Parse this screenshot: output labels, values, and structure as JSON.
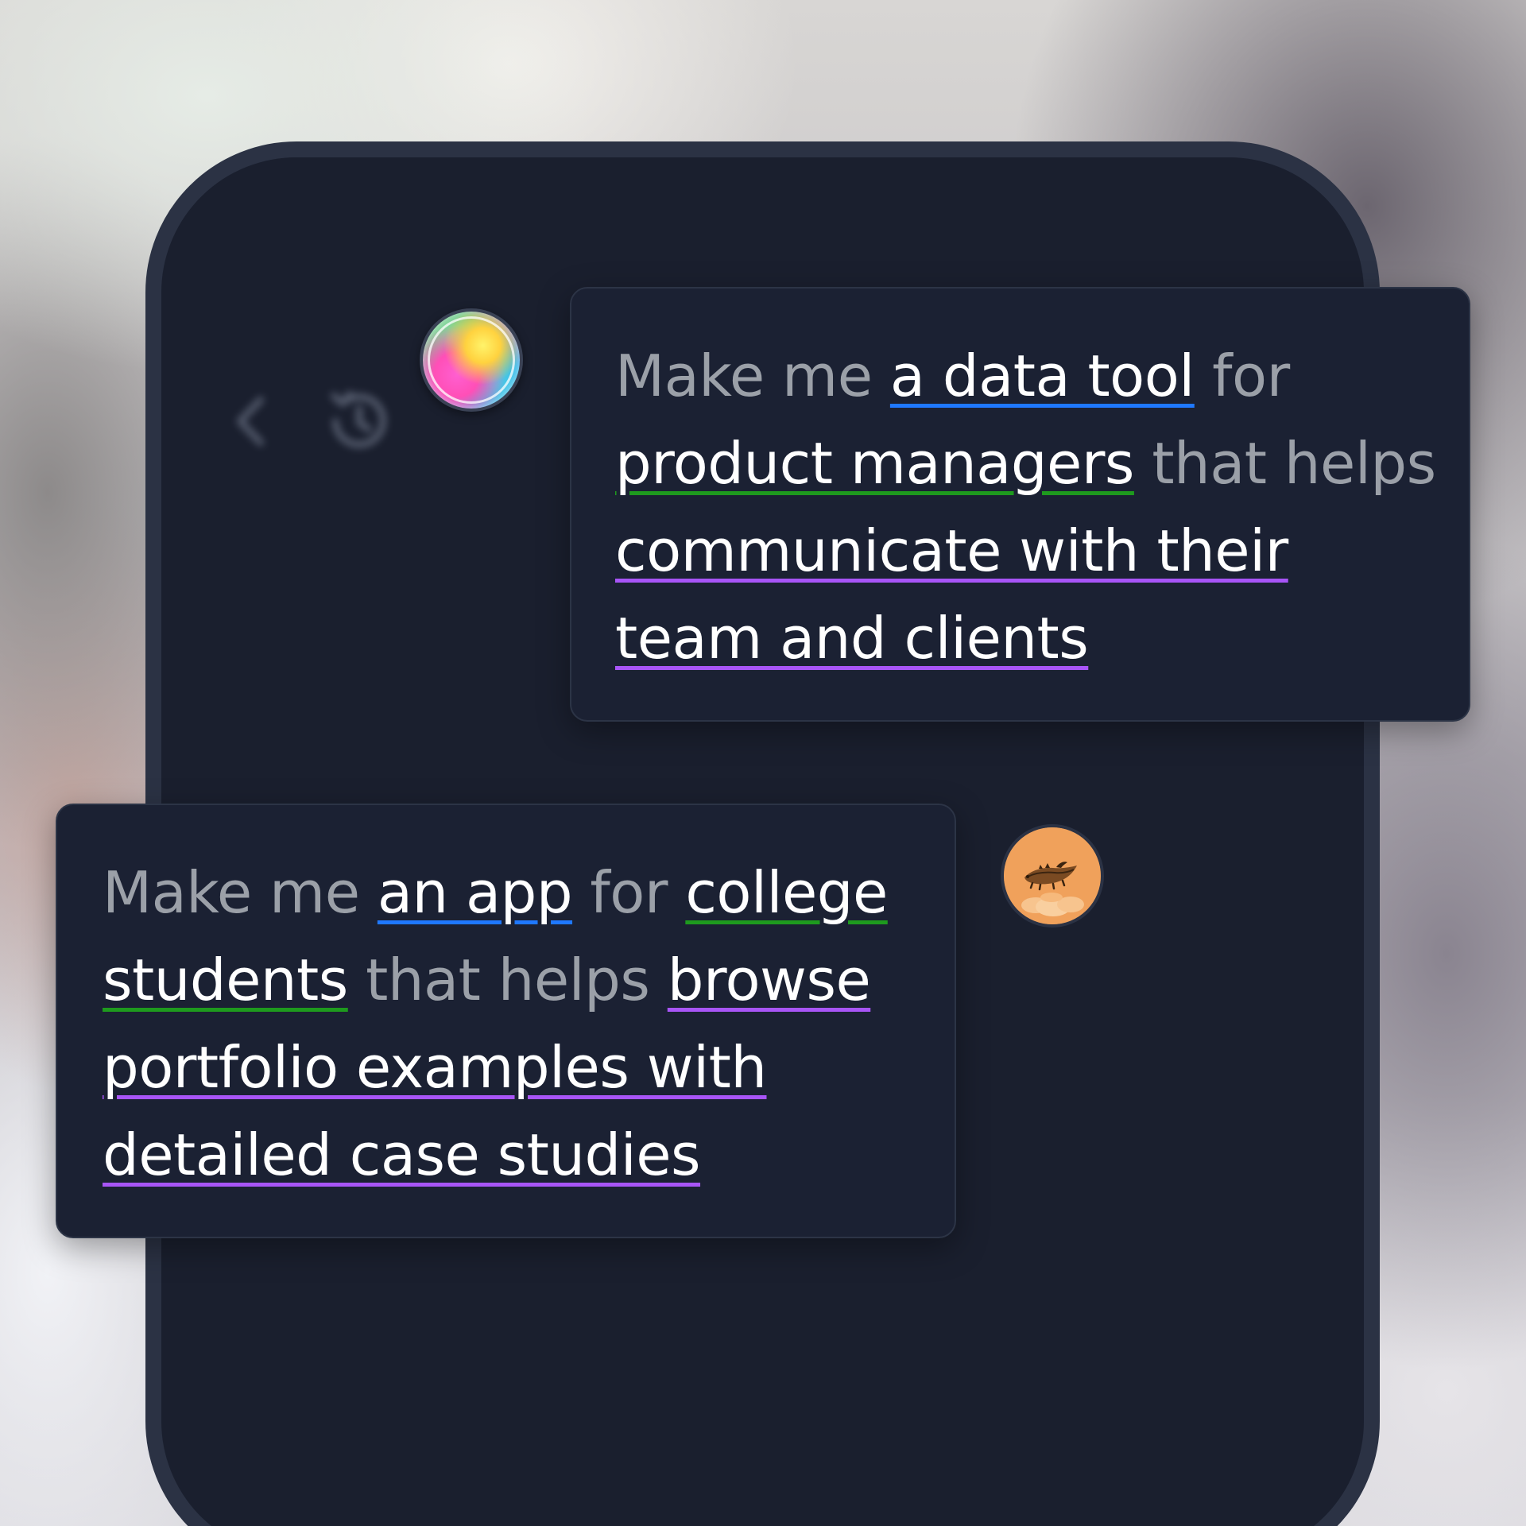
{
  "colors": {
    "phone_bg": "#1a1f2e",
    "bubble_bg": "#1b2133",
    "muted_text": "#9ba0a8",
    "highlight_text": "#ffffff",
    "underline_blue": "#1f78ff",
    "underline_green": "#1e9a1e",
    "underline_purple": "#a855f7",
    "user_avatar_bg": "#f0a15b"
  },
  "header": {
    "back_icon": "chevron-left-icon",
    "history_icon": "history-icon"
  },
  "ai_message": {
    "avatar_icon": "gradient-orb-avatar",
    "segments": [
      {
        "text": "Make me ",
        "style": "plain"
      },
      {
        "text": "a data tool",
        "style": "blue"
      },
      {
        "text": " for ",
        "style": "plain"
      },
      {
        "text": "product managers",
        "style": "green"
      },
      {
        "text": " that helps ",
        "style": "plain"
      },
      {
        "text": "communicate with their team and clients",
        "style": "purple"
      }
    ]
  },
  "user_message": {
    "avatar_icon": "flying-bison-avatar",
    "segments": [
      {
        "text": "Make me ",
        "style": "plain"
      },
      {
        "text": "an app",
        "style": "blue"
      },
      {
        "text": " for ",
        "style": "plain"
      },
      {
        "text": "college students",
        "style": "green"
      },
      {
        "text": " that helps ",
        "style": "plain"
      },
      {
        "text": "browse portfolio examples with detailed case studies",
        "style": "purple"
      }
    ]
  }
}
